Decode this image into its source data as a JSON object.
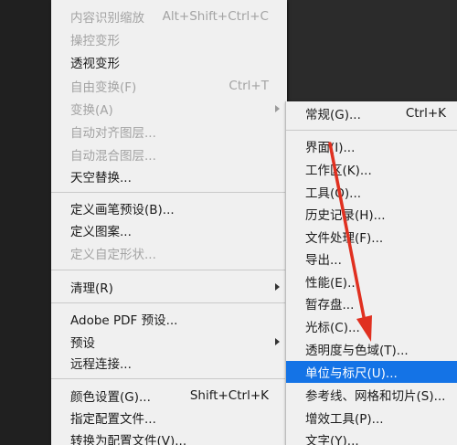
{
  "main_menu": {
    "items": [
      {
        "label": "内容识别缩放",
        "shortcut": "Alt+Shift+Ctrl+C",
        "disabled": true
      },
      {
        "label": "操控变形",
        "disabled": true
      },
      {
        "label": "透视变形",
        "disabled": false
      },
      {
        "label": "自由变换(F)",
        "shortcut": "Ctrl+T",
        "disabled": true
      },
      {
        "label": "变换(A)",
        "disabled": true,
        "submenu": true
      },
      {
        "label": "自动对齐图层...",
        "disabled": true
      },
      {
        "label": "自动混合图层...",
        "disabled": true
      },
      {
        "label": "天空替换...",
        "disabled": false
      },
      {
        "label": "定义画笔预设(B)...",
        "disabled": false
      },
      {
        "label": "定义图案...",
        "disabled": false
      },
      {
        "label": "定义自定形状...",
        "disabled": true
      },
      {
        "label": "清理(R)",
        "disabled": false,
        "submenu": true
      },
      {
        "label": "Adobe PDF 预设...",
        "disabled": false
      },
      {
        "label": "预设",
        "disabled": false,
        "submenu": true
      },
      {
        "label": "远程连接...",
        "disabled": false
      },
      {
        "label": "颜色设置(G)...",
        "shortcut": "Shift+Ctrl+K",
        "disabled": false
      },
      {
        "label": "指定配置文件...",
        "disabled": false
      },
      {
        "label": "转换为配置文件(V)...",
        "disabled": false
      }
    ]
  },
  "sub_menu": {
    "items": [
      {
        "label": "常规(G)...",
        "shortcut": "Ctrl+K"
      },
      {
        "label": "界面(I)..."
      },
      {
        "label": "工作区(K)..."
      },
      {
        "label": "工具(O)..."
      },
      {
        "label": "历史记录(H)..."
      },
      {
        "label": "文件处理(F)..."
      },
      {
        "label": "导出..."
      },
      {
        "label": "性能(E)..."
      },
      {
        "label": "暂存盘..."
      },
      {
        "label": "光标(C)..."
      },
      {
        "label": "透明度与色域(T)..."
      },
      {
        "label": "单位与标尺(U)...",
        "highlighted": true
      },
      {
        "label": "参考线、网格和切片(S)..."
      },
      {
        "label": "增效工具(P)..."
      },
      {
        "label": "文字(Y)..."
      }
    ]
  },
  "colors": {
    "highlight": "#1473e6",
    "annotation_arrow": "#e03020"
  }
}
